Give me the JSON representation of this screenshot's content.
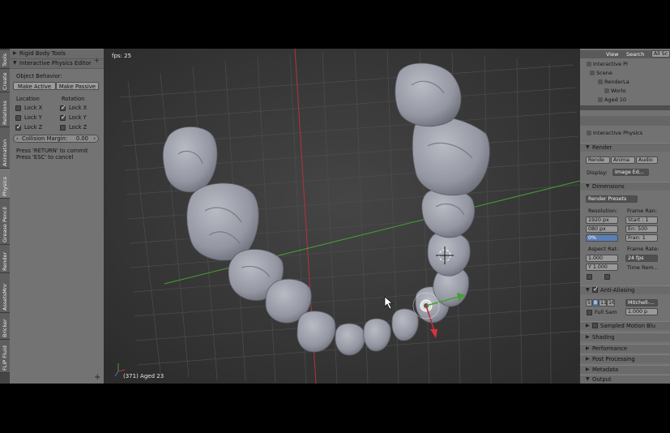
{
  "left_tabs": [
    "Tools",
    "Create",
    "Relations",
    "Animation",
    "Physics",
    "Grease Pencil",
    "Render",
    "AssetsMnr",
    "Bricker",
    "FLIP Fluid"
  ],
  "shelf": {
    "rigid_body_tools": "Rigid Body Tools",
    "editor_title": "Interactive Physics Editor",
    "object_behavior": "Object Behavior:",
    "make_active": "Make Active",
    "make_passive": "Make Passive",
    "location": "Location",
    "rotation": "Rotation",
    "loc": [
      {
        "label": "Lock X",
        "checked": false
      },
      {
        "label": "Lock Y",
        "checked": false
      },
      {
        "label": "Lock Z",
        "checked": true
      }
    ],
    "rot": [
      {
        "label": "Lock X",
        "checked": true
      },
      {
        "label": "Lock Y",
        "checked": true
      },
      {
        "label": "Lock Z",
        "checked": false
      }
    ],
    "collision_label": "Collision Margin:",
    "collision_value": "0.00",
    "hint1": "Press 'RETURN' to commit",
    "hint2": "Press 'ESC' to cancel"
  },
  "viewport": {
    "fps": "fps: 25",
    "object_info": "(371) Aged 23"
  },
  "outliner": {
    "view": "View",
    "search": "Search",
    "all_scenes": "All Sc",
    "items": [
      "Interactive Pl",
      "Scene",
      "RenderLa",
      "Worlo",
      "Aged 10"
    ]
  },
  "properties": {
    "header": "Interactive Physics",
    "render_section": "Render",
    "render_btn": "Rende",
    "anim_btn": "Anima",
    "audio_btn": "Audio",
    "display_label": "Display:",
    "display_value": "Image Ed...",
    "dimensions": "Dimensions",
    "render_presets": "Render Presets",
    "resolution": "Resolution:",
    "frame_range": "Frame Ran:",
    "res_x": "1920 px",
    "res_y": "080 px",
    "res_pct": "0%",
    "start": "Start : 1",
    "end": "En: 500",
    "frame_step": "Fran: 1",
    "aspect_ratio": "Aspect Rat:",
    "frame_rate": "Frame Rate:",
    "aspect_x": "1.000",
    "aspect_y": "Y 1.000",
    "fps_value": "24 fps",
    "time_remap": "Time Rem...",
    "anti_aliasing": "Anti-Aliasing",
    "aa_5": "5",
    "aa_8": "8",
    "aa_11": "11",
    "aa_16": "16",
    "aa_filter": "Mitchell-...",
    "full_sample": "Full Sam",
    "aa_size": "1.000 p",
    "sampled_motion_blur": "Sampled Motion Blu",
    "shading": "Shading",
    "performance": "Performance",
    "post_processing": "Post Processing",
    "metadata": "Metadata",
    "output": "Output"
  },
  "colors": {
    "x_axis": "#b4323c",
    "y_axis": "#46a032",
    "tooth": "#9a9ca6",
    "grid": "#4a4a4a"
  }
}
